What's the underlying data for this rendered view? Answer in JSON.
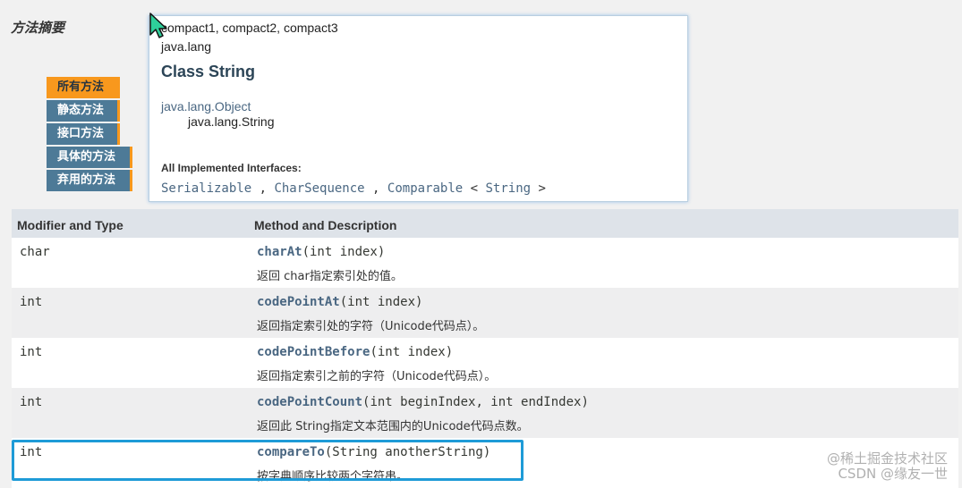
{
  "section_title": "方法摘要",
  "tabs": [
    {
      "label": "所有方法",
      "active": true
    },
    {
      "label": "静态方法",
      "active": false
    },
    {
      "label": "接口方法",
      "active": false
    },
    {
      "label": "具体的方法",
      "active": false
    },
    {
      "label": "弃用的方法",
      "active": false
    }
  ],
  "popup": {
    "modules": "compact1, compact2, compact3",
    "package": "java.lang",
    "class_title": "Class String",
    "hierarchy_parent": "java.lang.Object",
    "hierarchy_child": "java.lang.String",
    "impl_label": "All Implemented Interfaces:",
    "impl": {
      "i1": "Serializable",
      "sep1": " , ",
      "i2": "CharSequence",
      "sep2": " , ",
      "i3": "Comparable",
      "lt": " < ",
      "i4": "String",
      "gt": " >"
    }
  },
  "table": {
    "header_modifier": "Modifier and Type",
    "header_method": "Method and Description",
    "rows": [
      {
        "type": "char",
        "method": "charAt",
        "params": "(int index)",
        "desc": "返回 char指定索引处的值。"
      },
      {
        "type": "int",
        "method": "codePointAt",
        "params": "(int index)",
        "desc": "返回指定索引处的字符（Unicode代码点）。"
      },
      {
        "type": "int",
        "method": "codePointBefore",
        "params": "(int index)",
        "desc": "返回指定索引之前的字符（Unicode代码点）。"
      },
      {
        "type": "int",
        "method": "codePointCount",
        "params": "(int beginIndex, int endIndex)",
        "desc": "返回此 String指定文本范围内的Unicode代码点数。"
      },
      {
        "type": "int",
        "method": "compareTo",
        "params": "(String anotherString)",
        "desc": "按字典顺序比较两个字符串。"
      }
    ]
  },
  "watermark": {
    "line1": "@稀土掘金技术社区",
    "line2": "CSDN @缘友一世"
  },
  "colors": {
    "tab_active": "#f8981d",
    "tab_inactive": "#4d7a97",
    "highlight": "#1e9bd7",
    "link": "#4a6782"
  }
}
